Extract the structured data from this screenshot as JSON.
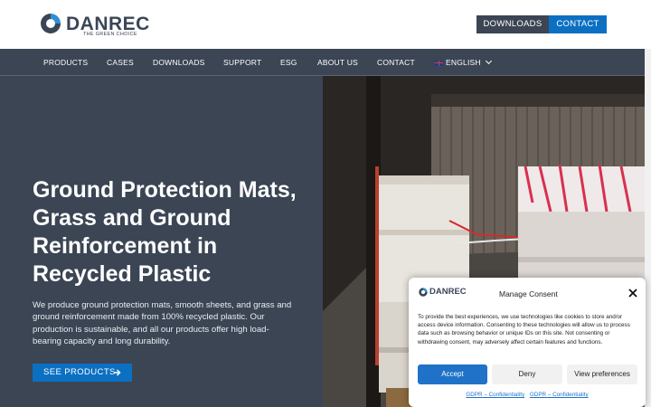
{
  "brand": {
    "name": "DANREC",
    "tagline": "THE GREEN CHOICE"
  },
  "header": {
    "downloads_label": "DOWNLOADS",
    "contact_label": "CONTACT"
  },
  "nav": {
    "items": [
      {
        "label": "PRODUCTS"
      },
      {
        "label": "CASES"
      },
      {
        "label": "DOWNLOADS"
      },
      {
        "label": "SUPPORT"
      },
      {
        "label": "ESG"
      },
      {
        "label": "ABOUT US"
      },
      {
        "label": "CONTACT"
      }
    ],
    "language": "ENGLISH"
  },
  "hero": {
    "title": "Ground Protection Mats, Grass and Ground Reinforcement in Recycled Plastic",
    "description": "We produce ground protection mats, smooth sheets, and grass and ground reinforcement made from 100% recycled plastic. Our production is sustainable, and all our products offer high load-bearing capacity and long durability.",
    "cta_label": "SEE PRODUCTS"
  },
  "consent": {
    "logo_text": "DANREC",
    "title": "Manage Consent",
    "text": "To provide the best experiences, we use technologies like cookies to store and/or access device information. Consenting to these technologies will allow us to process data such as browsing behavior or unique IDs on this site. Not consenting or withdrawing consent, may adversely affect certain features and functions.",
    "accept_label": "Accept",
    "deny_label": "Deny",
    "preferences_label": "View preferences",
    "links": [
      "GDPR – Confidentiality",
      "GDPR – Confidentiality"
    ]
  },
  "colors": {
    "navy": "#3b4554",
    "accent_blue": "#0c70c2",
    "consent_blue": "#1f72c7"
  },
  "icons": {
    "logo": "danrec-logo-icon",
    "flag": "uk-flag-icon",
    "chevron": "chevron-down-icon",
    "arrow": "arrow-right-icon",
    "close": "close-icon"
  }
}
